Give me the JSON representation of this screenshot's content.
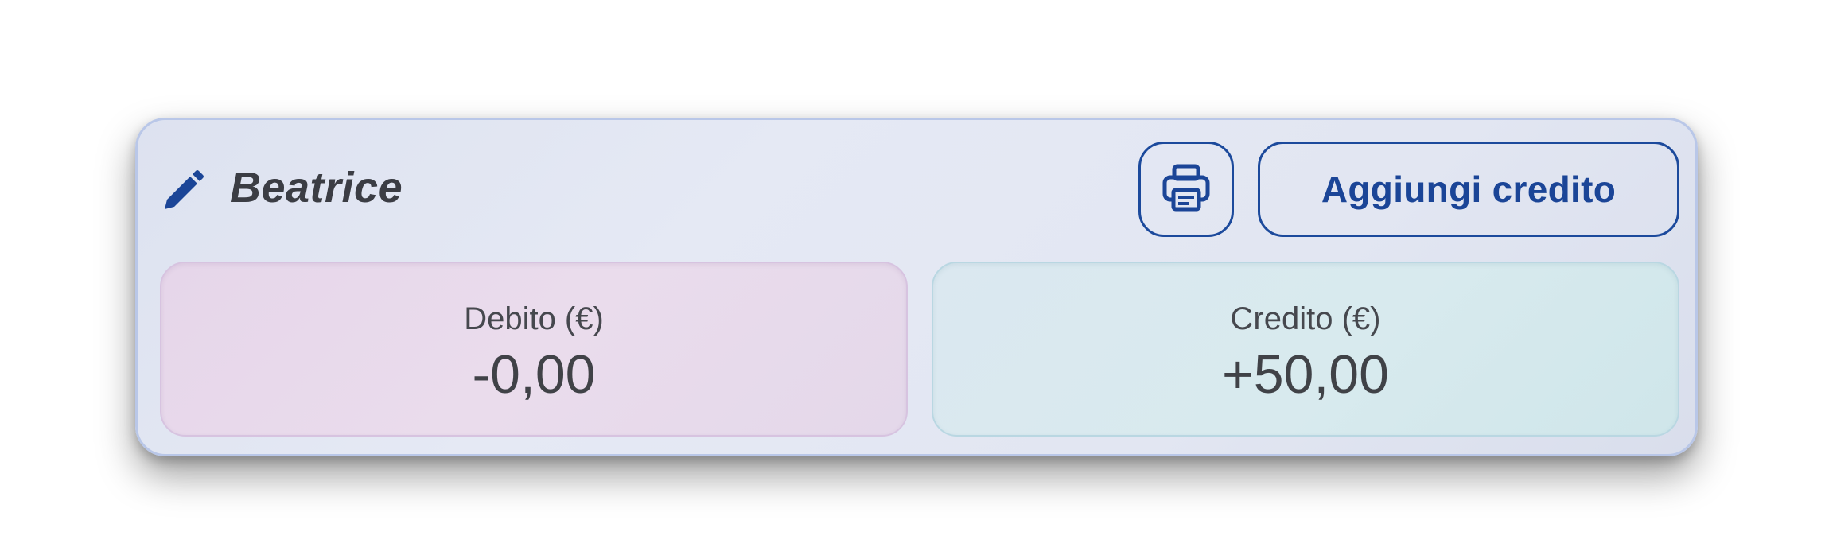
{
  "header": {
    "user_name": "Beatrice",
    "add_credit_label": "Aggiungi credito",
    "edit_icon": "pencil-icon",
    "print_icon": "printer-icon"
  },
  "balances": {
    "debit": {
      "label": "Debito (€)",
      "value": "-0,00"
    },
    "credit": {
      "label": "Credito (€)",
      "value": "+50,00"
    }
  },
  "colors": {
    "accent": "#1c4a9c",
    "name_text": "#3b3d44",
    "debit_panel": "#e8d9ec",
    "credit_panel": "#d6e9ee"
  }
}
